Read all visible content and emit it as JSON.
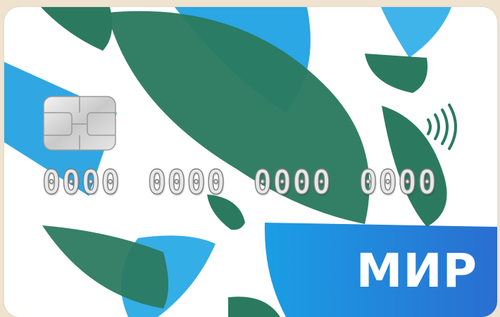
{
  "card": {
    "brand_logo": "МИР",
    "number_groups": [
      "0000",
      "0000",
      "0000",
      "0000"
    ]
  },
  "icons": {
    "chip": "chip-icon",
    "contactless": "contactless-icon"
  },
  "colors": {
    "green": "#2b7a60",
    "blue": "#1e9fe0",
    "light_blue": "#3fb4ea",
    "background": "#efe3cf",
    "card": "#ffffff"
  }
}
